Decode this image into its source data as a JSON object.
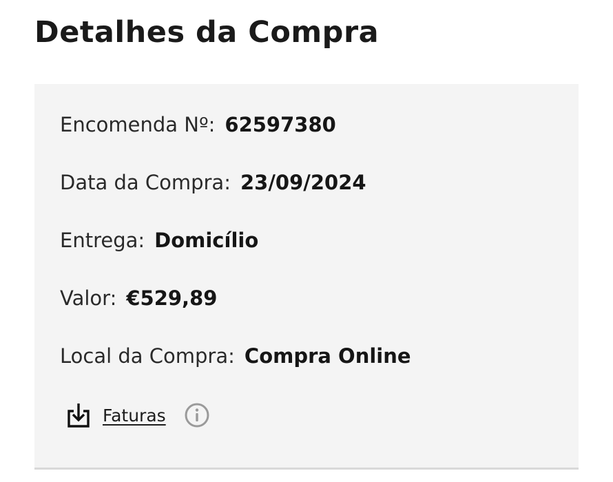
{
  "page": {
    "title": "Detalhes da Compra"
  },
  "details": {
    "order": {
      "label": "Encomenda Nº:",
      "value": "62597380"
    },
    "purchase_date": {
      "label": "Data da Compra:",
      "value": "23/09/2024"
    },
    "delivery": {
      "label": "Entrega:",
      "value": "Domicílio"
    },
    "amount": {
      "label": "Valor:",
      "value": "€529,89"
    },
    "purchase_place": {
      "label": "Local da Compra:",
      "value": "Compra Online"
    }
  },
  "invoices": {
    "link_label": "Faturas",
    "download_icon": "download-icon",
    "info_icon": "info-icon"
  },
  "colors": {
    "card_background": "#f4f4f4",
    "text": "#1c1c1c",
    "icon_gray": "#9a9a9a"
  }
}
